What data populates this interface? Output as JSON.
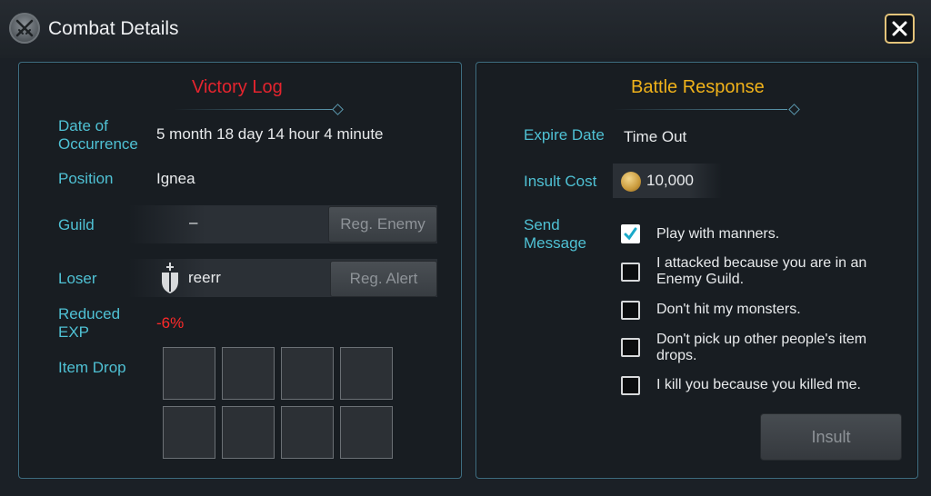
{
  "window": {
    "title": "Combat Details",
    "emblem": "crossed-swords-icon",
    "close_icon": "close-icon"
  },
  "victory_log": {
    "title": "Victory Log",
    "date_label": "Date of Occurrence",
    "date_value": "5 month 18 day 14 hour 4 minute",
    "position_label": "Position",
    "position_value": "Ignea",
    "guild_label": "Guild",
    "guild_value": "–",
    "reg_enemy_button": "Reg. Enemy",
    "loser_label": "Loser",
    "loser_value": "reerr",
    "loser_class_icon": "sword-shield-icon",
    "reg_alert_button": "Reg. Alert",
    "reduced_exp_label": "Reduced EXP",
    "reduced_exp_value": "-6%",
    "item_drop_label": "Item Drop",
    "item_slots": [
      "",
      "",
      "",
      "",
      "",
      "",
      "",
      ""
    ]
  },
  "battle_response": {
    "title": "Battle Response",
    "expire_label": "Expire Date",
    "expire_value": "Time Out",
    "insult_cost_label": "Insult Cost",
    "insult_cost_value": "10,000",
    "currency_icon": "gold-coin-icon",
    "send_message_label": "Send Message",
    "messages": [
      {
        "text": "Play with manners.",
        "checked": true
      },
      {
        "text": "I attacked because you are in an Enemy Guild.",
        "checked": false
      },
      {
        "text": "Don't hit my monsters.",
        "checked": false
      },
      {
        "text": "Don't pick up other people's item drops.",
        "checked": false
      },
      {
        "text": "I kill you because you killed me.",
        "checked": false
      }
    ],
    "insult_button": "Insult"
  },
  "colors": {
    "victory_title": "#e5242e",
    "response_title": "#f0b21a",
    "label": "#4fc1d4",
    "negative": "#ff2a2a",
    "close_border": "#e3c37a"
  }
}
